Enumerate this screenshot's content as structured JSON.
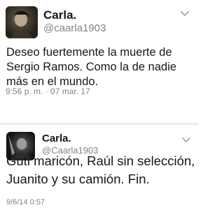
{
  "tweets": [
    {
      "display_name": "Carla.",
      "handle": "@caarla1903",
      "text": "Deseo fuertemente la muerte de Sergio Ramos. Como la de nadie más en el mundo.",
      "timestamp": "9:56 p. m. · 07 mar. 17",
      "menu_icon": "chevron-down-icon"
    },
    {
      "display_name": "Carla.",
      "handle": "@Caarla1903",
      "text": "Guti maricón, Raúl sin selección, Juanito y su camión. Fin.",
      "timestamp": "9/6/14 0:57",
      "menu_icon": "chevron-down-icon"
    }
  ],
  "colors": {
    "text": "#14171a",
    "secondary_text": "#7d868d",
    "divider": "#e9ecee"
  }
}
